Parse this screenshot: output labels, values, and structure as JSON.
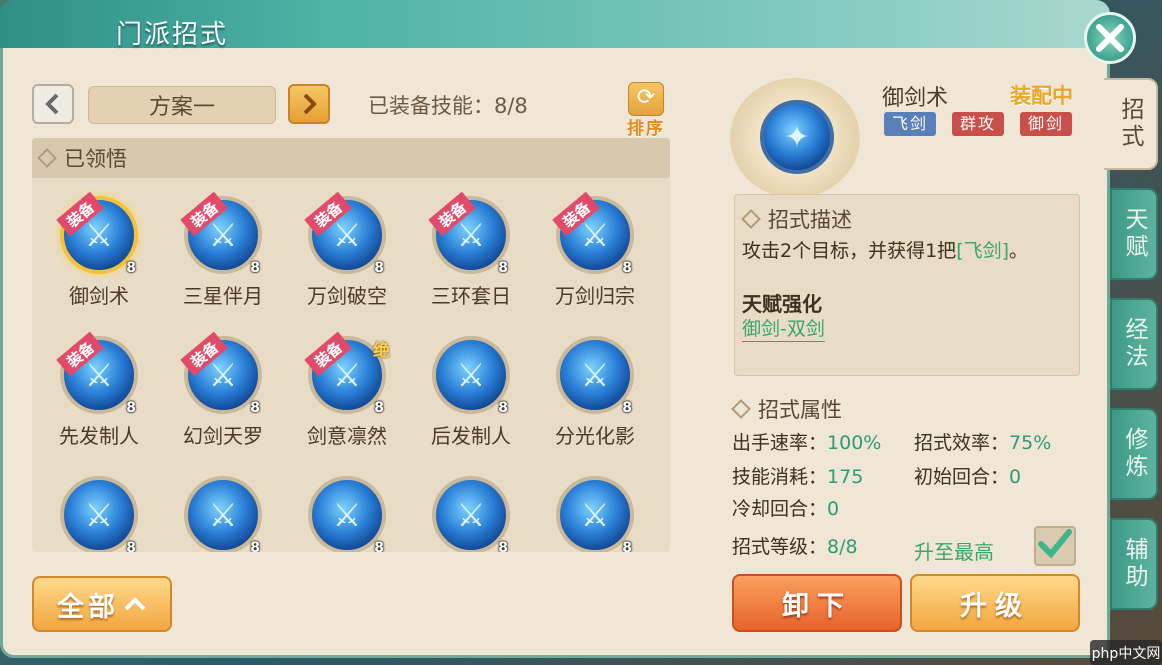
{
  "window": {
    "title": "门派招式",
    "close_icon": "close-icon"
  },
  "scheme": {
    "prev_icon": "chevron-left-icon",
    "name": "方案一",
    "next_icon": "chevron-right-icon",
    "equipped_label": "已装备技能：8/8",
    "sort_label": "排序",
    "sort_icon": "refresh-icon"
  },
  "section": {
    "learned": "已领悟"
  },
  "skills": [
    {
      "name": "御剑术",
      "equip": "装备",
      "level": "8",
      "extra": "",
      "selected": true
    },
    {
      "name": "三星伴月",
      "equip": "装备",
      "level": "8",
      "extra": ""
    },
    {
      "name": "万剑破空",
      "equip": "装备",
      "level": "8",
      "extra": ""
    },
    {
      "name": "三环套日",
      "equip": "装备",
      "level": "8",
      "extra": ""
    },
    {
      "name": "万剑归宗",
      "equip": "装备",
      "level": "8",
      "extra": ""
    },
    {
      "name": "先发制人",
      "equip": "装备",
      "level": "8",
      "extra": ""
    },
    {
      "name": "幻剑天罗",
      "equip": "装备",
      "level": "8",
      "extra": ""
    },
    {
      "name": "剑意凛然",
      "equip": "装备",
      "level": "8",
      "extra": "绝"
    },
    {
      "name": "后发制人",
      "equip": "",
      "level": "8",
      "extra": ""
    },
    {
      "name": "分光化影",
      "equip": "",
      "level": "8",
      "extra": ""
    },
    {
      "name": "",
      "equip": "",
      "level": "8",
      "extra": ""
    },
    {
      "name": "",
      "equip": "",
      "level": "8",
      "extra": ""
    },
    {
      "name": "",
      "equip": "",
      "level": "8",
      "extra": ""
    },
    {
      "name": "",
      "equip": "",
      "level": "8",
      "extra": ""
    },
    {
      "name": "",
      "equip": "",
      "level": "8",
      "extra": ""
    }
  ],
  "filter": {
    "all_label": "全部",
    "arrow_icon": "chevron-up-icon"
  },
  "detail": {
    "name": "御剑术",
    "status": "装配中",
    "tags": [
      {
        "text": "飞剑",
        "color": "#5b7fb8"
      },
      {
        "text": "群攻",
        "color": "#c9504a"
      },
      {
        "text": "御剑",
        "color": "#c9504a"
      }
    ],
    "desc_head": "招式描述",
    "desc_prefix": "攻击2个目标，并获得1把",
    "desc_highlight": "[飞剑]",
    "desc_suffix": "。",
    "talent_head": "天赋强化",
    "talent_link": "御剑-双剑",
    "attr_head": "招式属性",
    "attrs": {
      "speed_label": "出手速率：",
      "speed": "100%",
      "eff_label": "招式效率：",
      "eff": "75%",
      "cost_label": "技能消耗：",
      "cost": "175",
      "init_label": "初始回合：",
      "init": "0",
      "cd_label": "冷却回合：",
      "cd": "0",
      "level_label": "招式等级：",
      "level": "8/8"
    },
    "max_label": "升至最高",
    "max_checked": true
  },
  "actions": {
    "unload": "卸下",
    "upgrade": "升级"
  },
  "side_tabs": [
    {
      "label": "招式",
      "active": true
    },
    {
      "label": "天赋",
      "active": false
    },
    {
      "label": "经法",
      "active": false
    },
    {
      "label": "修炼",
      "active": false
    },
    {
      "label": "辅助",
      "active": false
    }
  ],
  "watermark": "php中文网"
}
